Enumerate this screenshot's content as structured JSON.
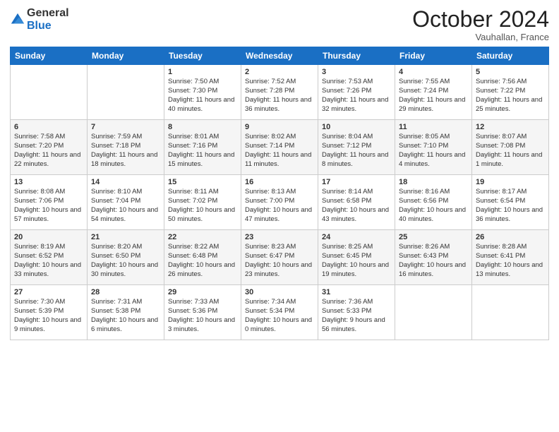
{
  "header": {
    "logo_line1": "General",
    "logo_line2": "Blue",
    "month": "October 2024",
    "location": "Vauhallan, France"
  },
  "columns": [
    "Sunday",
    "Monday",
    "Tuesday",
    "Wednesday",
    "Thursday",
    "Friday",
    "Saturday"
  ],
  "weeks": [
    [
      {
        "day": "",
        "sunrise": "",
        "sunset": "",
        "daylight": ""
      },
      {
        "day": "",
        "sunrise": "",
        "sunset": "",
        "daylight": ""
      },
      {
        "day": "1",
        "sunrise": "Sunrise: 7:50 AM",
        "sunset": "Sunset: 7:30 PM",
        "daylight": "Daylight: 11 hours and 40 minutes."
      },
      {
        "day": "2",
        "sunrise": "Sunrise: 7:52 AM",
        "sunset": "Sunset: 7:28 PM",
        "daylight": "Daylight: 11 hours and 36 minutes."
      },
      {
        "day": "3",
        "sunrise": "Sunrise: 7:53 AM",
        "sunset": "Sunset: 7:26 PM",
        "daylight": "Daylight: 11 hours and 32 minutes."
      },
      {
        "day": "4",
        "sunrise": "Sunrise: 7:55 AM",
        "sunset": "Sunset: 7:24 PM",
        "daylight": "Daylight: 11 hours and 29 minutes."
      },
      {
        "day": "5",
        "sunrise": "Sunrise: 7:56 AM",
        "sunset": "Sunset: 7:22 PM",
        "daylight": "Daylight: 11 hours and 25 minutes."
      }
    ],
    [
      {
        "day": "6",
        "sunrise": "Sunrise: 7:58 AM",
        "sunset": "Sunset: 7:20 PM",
        "daylight": "Daylight: 11 hours and 22 minutes."
      },
      {
        "day": "7",
        "sunrise": "Sunrise: 7:59 AM",
        "sunset": "Sunset: 7:18 PM",
        "daylight": "Daylight: 11 hours and 18 minutes."
      },
      {
        "day": "8",
        "sunrise": "Sunrise: 8:01 AM",
        "sunset": "Sunset: 7:16 PM",
        "daylight": "Daylight: 11 hours and 15 minutes."
      },
      {
        "day": "9",
        "sunrise": "Sunrise: 8:02 AM",
        "sunset": "Sunset: 7:14 PM",
        "daylight": "Daylight: 11 hours and 11 minutes."
      },
      {
        "day": "10",
        "sunrise": "Sunrise: 8:04 AM",
        "sunset": "Sunset: 7:12 PM",
        "daylight": "Daylight: 11 hours and 8 minutes."
      },
      {
        "day": "11",
        "sunrise": "Sunrise: 8:05 AM",
        "sunset": "Sunset: 7:10 PM",
        "daylight": "Daylight: 11 hours and 4 minutes."
      },
      {
        "day": "12",
        "sunrise": "Sunrise: 8:07 AM",
        "sunset": "Sunset: 7:08 PM",
        "daylight": "Daylight: 11 hours and 1 minute."
      }
    ],
    [
      {
        "day": "13",
        "sunrise": "Sunrise: 8:08 AM",
        "sunset": "Sunset: 7:06 PM",
        "daylight": "Daylight: 10 hours and 57 minutes."
      },
      {
        "day": "14",
        "sunrise": "Sunrise: 8:10 AM",
        "sunset": "Sunset: 7:04 PM",
        "daylight": "Daylight: 10 hours and 54 minutes."
      },
      {
        "day": "15",
        "sunrise": "Sunrise: 8:11 AM",
        "sunset": "Sunset: 7:02 PM",
        "daylight": "Daylight: 10 hours and 50 minutes."
      },
      {
        "day": "16",
        "sunrise": "Sunrise: 8:13 AM",
        "sunset": "Sunset: 7:00 PM",
        "daylight": "Daylight: 10 hours and 47 minutes."
      },
      {
        "day": "17",
        "sunrise": "Sunrise: 8:14 AM",
        "sunset": "Sunset: 6:58 PM",
        "daylight": "Daylight: 10 hours and 43 minutes."
      },
      {
        "day": "18",
        "sunrise": "Sunrise: 8:16 AM",
        "sunset": "Sunset: 6:56 PM",
        "daylight": "Daylight: 10 hours and 40 minutes."
      },
      {
        "day": "19",
        "sunrise": "Sunrise: 8:17 AM",
        "sunset": "Sunset: 6:54 PM",
        "daylight": "Daylight: 10 hours and 36 minutes."
      }
    ],
    [
      {
        "day": "20",
        "sunrise": "Sunrise: 8:19 AM",
        "sunset": "Sunset: 6:52 PM",
        "daylight": "Daylight: 10 hours and 33 minutes."
      },
      {
        "day": "21",
        "sunrise": "Sunrise: 8:20 AM",
        "sunset": "Sunset: 6:50 PM",
        "daylight": "Daylight: 10 hours and 30 minutes."
      },
      {
        "day": "22",
        "sunrise": "Sunrise: 8:22 AM",
        "sunset": "Sunset: 6:48 PM",
        "daylight": "Daylight: 10 hours and 26 minutes."
      },
      {
        "day": "23",
        "sunrise": "Sunrise: 8:23 AM",
        "sunset": "Sunset: 6:47 PM",
        "daylight": "Daylight: 10 hours and 23 minutes."
      },
      {
        "day": "24",
        "sunrise": "Sunrise: 8:25 AM",
        "sunset": "Sunset: 6:45 PM",
        "daylight": "Daylight: 10 hours and 19 minutes."
      },
      {
        "day": "25",
        "sunrise": "Sunrise: 8:26 AM",
        "sunset": "Sunset: 6:43 PM",
        "daylight": "Daylight: 10 hours and 16 minutes."
      },
      {
        "day": "26",
        "sunrise": "Sunrise: 8:28 AM",
        "sunset": "Sunset: 6:41 PM",
        "daylight": "Daylight: 10 hours and 13 minutes."
      }
    ],
    [
      {
        "day": "27",
        "sunrise": "Sunrise: 7:30 AM",
        "sunset": "Sunset: 5:39 PM",
        "daylight": "Daylight: 10 hours and 9 minutes."
      },
      {
        "day": "28",
        "sunrise": "Sunrise: 7:31 AM",
        "sunset": "Sunset: 5:38 PM",
        "daylight": "Daylight: 10 hours and 6 minutes."
      },
      {
        "day": "29",
        "sunrise": "Sunrise: 7:33 AM",
        "sunset": "Sunset: 5:36 PM",
        "daylight": "Daylight: 10 hours and 3 minutes."
      },
      {
        "day": "30",
        "sunrise": "Sunrise: 7:34 AM",
        "sunset": "Sunset: 5:34 PM",
        "daylight": "Daylight: 10 hours and 0 minutes."
      },
      {
        "day": "31",
        "sunrise": "Sunrise: 7:36 AM",
        "sunset": "Sunset: 5:33 PM",
        "daylight": "Daylight: 9 hours and 56 minutes."
      },
      {
        "day": "",
        "sunrise": "",
        "sunset": "",
        "daylight": ""
      },
      {
        "day": "",
        "sunrise": "",
        "sunset": "",
        "daylight": ""
      }
    ]
  ]
}
